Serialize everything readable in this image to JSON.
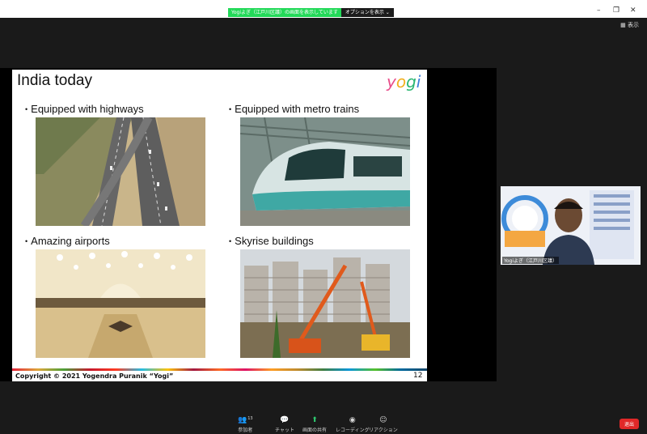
{
  "share_banner": {
    "message": "Yogiよぎ（江戸川区議）の画面を表示しています",
    "options_label": "オプションを表示 ⌄"
  },
  "window_controls": {
    "minimize": "–",
    "restore": "❐",
    "close": "✕"
  },
  "view_button": "▦ 表示",
  "slide": {
    "title": "India today",
    "logo_letters": [
      "y",
      "o",
      "g",
      "i"
    ],
    "bullets": [
      {
        "text": "Equipped with highways"
      },
      {
        "text": "Equipped with metro trains"
      },
      {
        "text": "Amazing airports"
      },
      {
        "text": "Skyrise buildings"
      }
    ],
    "footer": "Copyright © 2021 Yogendra Puranik “Yogi”",
    "page_number": "12"
  },
  "video": {
    "name": "Yogiよぎ（江戸川区議）"
  },
  "toolbar": {
    "participants": {
      "label": "参加者",
      "count": "13"
    },
    "chat": {
      "label": "チャット"
    },
    "share": {
      "label": "画面の共有"
    },
    "record": {
      "label": "レコーディング"
    },
    "reactions": {
      "label": "リアクション"
    },
    "end": "退出"
  }
}
